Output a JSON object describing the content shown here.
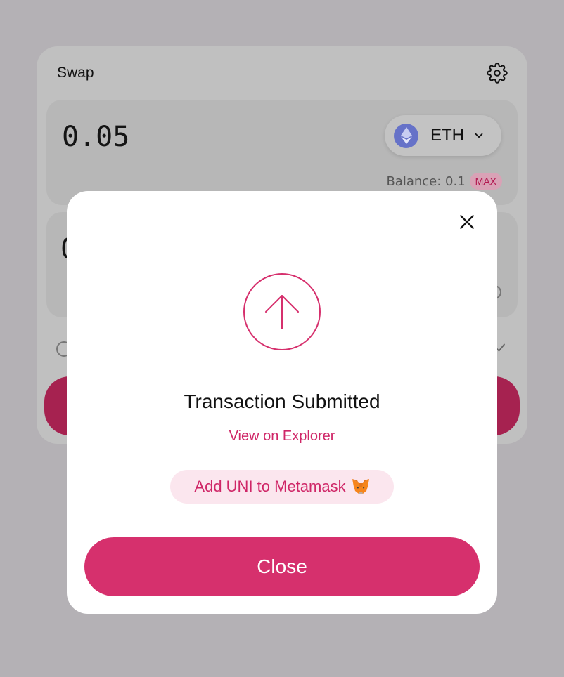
{
  "swap": {
    "title": "Swap",
    "input_amount": "0.05",
    "token_symbol": "ETH",
    "balance_label": "Balance: 0.1",
    "max_label": "MAX",
    "output_amount_partial": "0"
  },
  "modal": {
    "title": "Transaction Submitted",
    "explorer_link": "View on Explorer",
    "add_token_label": "Add UNI to Metamask",
    "close_label": "Close"
  },
  "colors": {
    "accent": "#d6306d",
    "accent_light": "#fbe6ee",
    "overlay": "#b4b1b5"
  },
  "icons": {
    "settings": "gear-icon",
    "close": "close-icon",
    "submitted": "arrow-up-circle-icon",
    "token": "ethereum-icon",
    "wallet": "metamask-fox-icon"
  }
}
